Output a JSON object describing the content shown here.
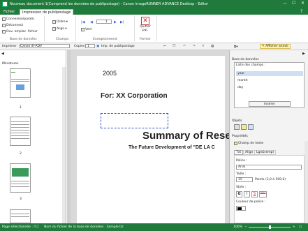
{
  "window": {
    "title": "Nouveau document 1(Comprend les données de publipostage) - Canon imageRUNNER ADVANCE Desktop - Editor",
    "min": "—",
    "max": "☐",
    "close": "✕"
  },
  "tabs": {
    "file": "Fichier",
    "mailmerge": "Impression de publipostage"
  },
  "ribbon": {
    "connect": "Connexion/param.",
    "disconnect": "Déconnect",
    "open_file": "Ouv. emplac. fichier",
    "db_group": "Base de données",
    "order": "Ordre",
    "align": "Align",
    "fields_group": "Champs",
    "rec_current": "1",
    "vert": "Vert",
    "rec_group": "Enregistrement",
    "quit": "Quitter",
    "quit2": "par.",
    "close_group": "Fermer"
  },
  "toolbar": {
    "print": "Imprimer",
    "printer": "Canon iR-ADV",
    "copies_label": "Copies",
    "copies": "1",
    "imp": "Imp. de publipostage",
    "show_annot": "Afficher annot."
  },
  "left": {
    "title": "Miniatures",
    "pages": [
      "1",
      "2",
      "3"
    ]
  },
  "document": {
    "year": "2005",
    "for": "For: XX Corporation",
    "summary": "Summary of Rese",
    "subtitle": "The Future Development of \"DE LA C"
  },
  "right": {
    "db_header": "Base de données",
    "field_list_label": "Liste des champs :",
    "fields": [
      "year",
      "month",
      "day"
    ],
    "insert_btn": "Insérer",
    "objects_label": "Objets",
    "props_label": "Propriétés",
    "text_field": "Champ de texte",
    "ptabs": [
      "Txt",
      "Align",
      "Lgn&rempl"
    ],
    "police_label": "Police :",
    "police": "Arial",
    "taille_label": "Taille :",
    "taille": "15",
    "points": "Points (3,0 à 500,0)",
    "style_label": "Style :",
    "styles": [
      "G",
      "I",
      "S",
      "abc"
    ],
    "couleur_label": "Couleur de police :"
  },
  "status": {
    "page": "Page sélectionnée : /11",
    "db": "Nom du fichier de la base de données : Sample.tsl",
    "zoom": "100%"
  }
}
